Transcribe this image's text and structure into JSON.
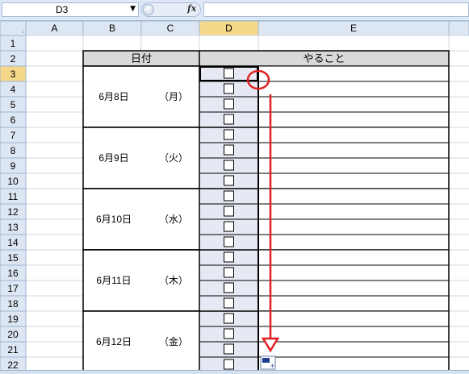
{
  "formula_bar": {
    "name_box": "D3",
    "name_box_dropdown_icon": "triangle-down",
    "function_icon_label": "fx",
    "formula_value": ""
  },
  "columns": [
    "A",
    "B",
    "C",
    "D",
    "E"
  ],
  "selected_column": "D",
  "rows": [
    "1",
    "2",
    "3",
    "4",
    "5",
    "6",
    "7",
    "8",
    "9",
    "10",
    "11",
    "12",
    "13",
    "14",
    "15",
    "16",
    "17",
    "18",
    "19",
    "20",
    "21",
    "22"
  ],
  "selected_row": "3",
  "table": {
    "header_date": "日付",
    "header_todo": "やること",
    "days": [
      {
        "date": "6月8日",
        "weekday": "（月）"
      },
      {
        "date": "6月9日",
        "weekday": "（火）"
      },
      {
        "date": "6月10日",
        "weekday": "（水）"
      },
      {
        "date": "6月11日",
        "weekday": "（木）"
      },
      {
        "date": "6月12日",
        "weekday": "（金）"
      }
    ],
    "checkbox_glyph": "□"
  },
  "colors": {
    "header_bg": "#dde7f3",
    "header_selected_bg": "#f6d88b",
    "grid_line": "#d0d7e5",
    "table_header_bg": "#d9d9d9",
    "checkbox_column_bg": "#e6e9f3",
    "annotation_red": "#e02020"
  },
  "annotation": {
    "type": "fill-drag arrow",
    "icon": "autofill-options-icon"
  }
}
